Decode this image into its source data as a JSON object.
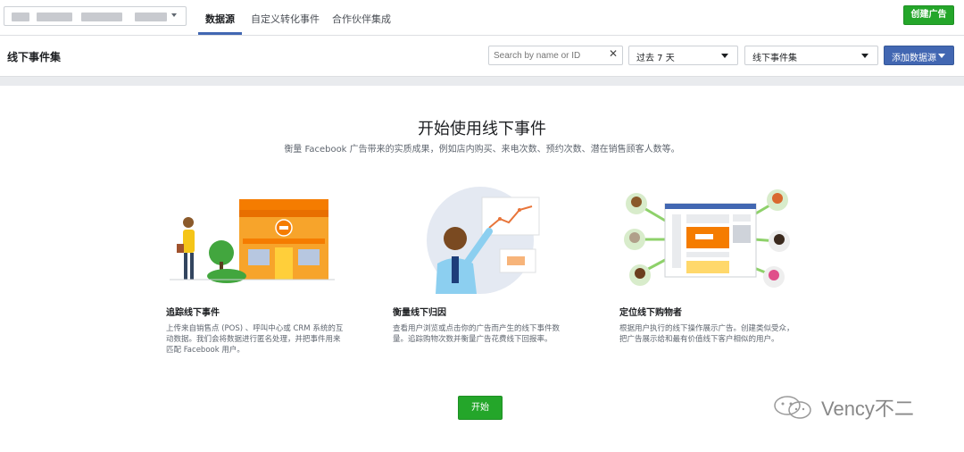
{
  "topnav": {
    "tabs": [
      {
        "label": "数据源",
        "active": true
      },
      {
        "label": "自定义转化事件",
        "active": false
      },
      {
        "label": "合作伙伴集成",
        "active": false
      }
    ],
    "create_ad": "创建广告"
  },
  "toolbar": {
    "title": "线下事件集",
    "search_placeholder": "Search by name or ID",
    "date_range": "过去 7 天",
    "event_set": "线下事件集",
    "add_source": "添加数据源"
  },
  "hero": {
    "title": "开始使用线下事件",
    "subtitle": "衡量 Facebook 广告带来的实质成果，例如店内购买、来电次数、预约次数、潜在销售顾客人数等。"
  },
  "features": [
    {
      "title": "追踪线下事件",
      "desc": "上传来自销售点 (POS) 、呼叫中心或 CRM 系统的互动数据。我们会将数据进行匿名处理，并把事件用来匹配 Facebook 用户。"
    },
    {
      "title": "衡量线下归因",
      "desc": "查看用户浏览或点击你的广告而产生的线下事件数量。追踪购物次数并衡量广告花费线下回报率。"
    },
    {
      "title": "定位线下购物者",
      "desc": "根据用户执行的线下操作展示广告。创建类似受众，把广告展示给和最有价值线下客户相似的用户。"
    }
  ],
  "start_button": "开始",
  "watermark": "Vency不二",
  "colors": {
    "primary": "#4267b2",
    "green": "#24a62a",
    "orange": "#f57c00"
  }
}
